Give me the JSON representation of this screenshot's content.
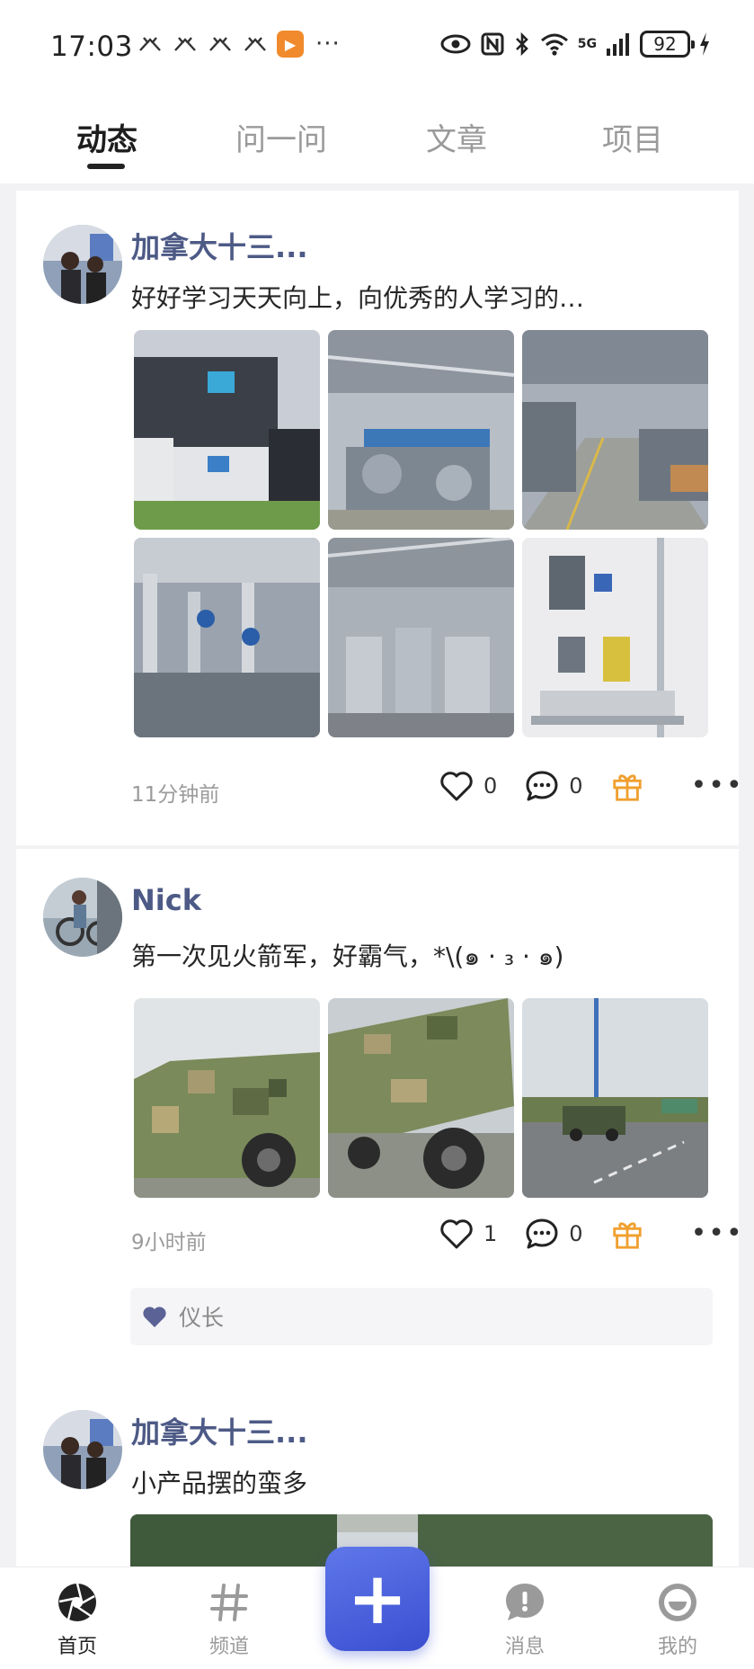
{
  "status_bar": {
    "time": "17:03",
    "more_indicator": "···",
    "network": "5G",
    "battery": "92",
    "icons": [
      "notification-icon",
      "notification-icon",
      "notification-icon",
      "notification-icon",
      "video-app-icon",
      "eye-icon",
      "nfc-icon",
      "bluetooth-icon",
      "wifi-icon",
      "signal-icon",
      "battery-icon",
      "charging-icon"
    ]
  },
  "tabs": [
    {
      "label": "动态",
      "active": true
    },
    {
      "label": "问一问",
      "active": false
    },
    {
      "label": "文章",
      "active": false
    },
    {
      "label": "项目",
      "active": false
    }
  ],
  "posts": [
    {
      "username": "加拿大十三...",
      "text": "好好学习天天向上，向优秀的人学习的…",
      "image_count": 6,
      "time": "11分钟前",
      "likes": "0",
      "comments": "0"
    },
    {
      "username": "Nick",
      "text": "第一次见火箭军，好霸气，*\\(๑ · ₃ · ๑)",
      "image_count": 3,
      "time": "9小时前",
      "likes": "1",
      "comments": "0",
      "liked_by": "仪长"
    },
    {
      "username": "加拿大十三...",
      "text": "小产品摆的蛮多",
      "image_count": 1
    }
  ],
  "bottom_nav": [
    {
      "label": "首页",
      "icon": "aperture-icon",
      "active": true
    },
    {
      "label": "频道",
      "icon": "hashtag-icon",
      "active": false
    },
    {
      "label": "",
      "icon": "plus-icon",
      "active": false
    },
    {
      "label": "消息",
      "icon": "message-icon",
      "active": false
    },
    {
      "label": "我的",
      "icon": "profile-icon",
      "active": false
    }
  ],
  "colors": {
    "username": "#4d5a86",
    "accent_gift": "#f0a030",
    "fab": "#4a61de",
    "like_heart_filled": "#5b6296"
  }
}
